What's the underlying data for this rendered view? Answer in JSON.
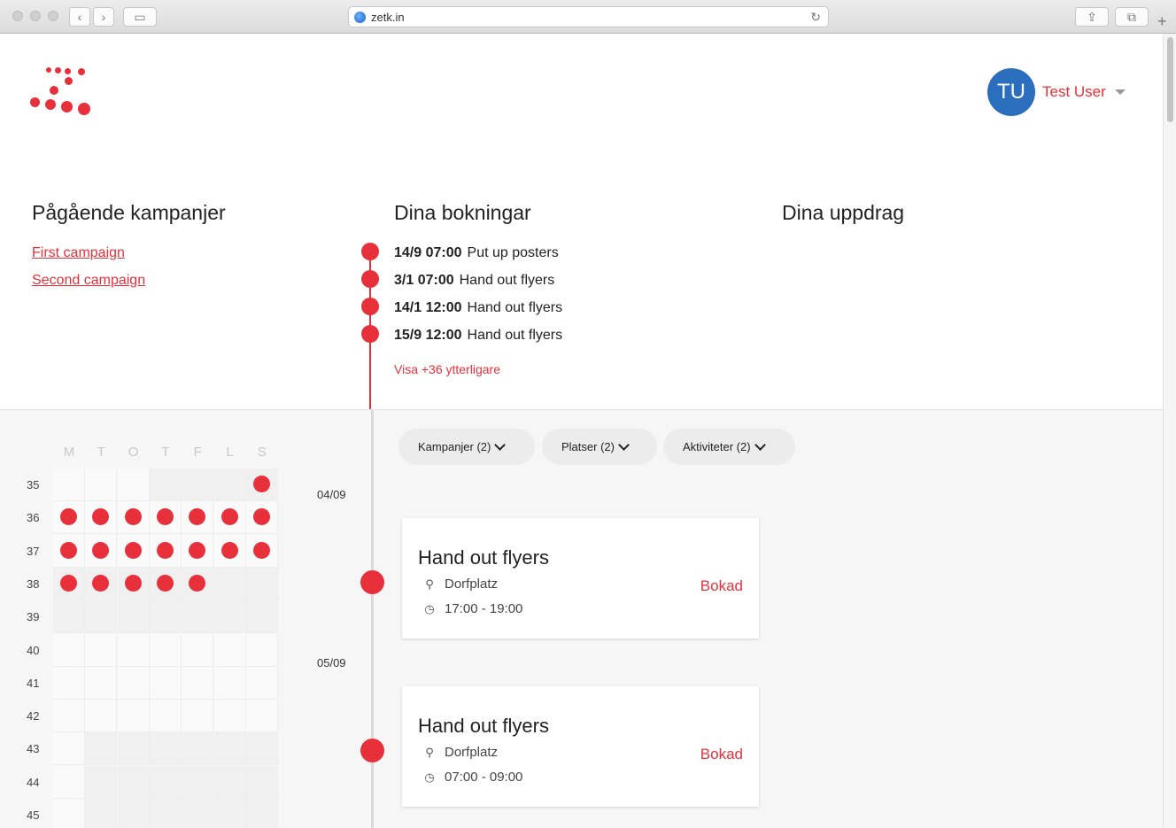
{
  "browser": {
    "url": "zetk.in"
  },
  "user": {
    "initials": "TU",
    "name": "Test User"
  },
  "columns": {
    "campaigns_title": "Pågående kampanjer",
    "bookings_title": "Dina bokningar",
    "assignments_title": "Dina uppdrag"
  },
  "campaigns": [
    "First campaign",
    "Second campaign"
  ],
  "bookings": [
    {
      "date": "14/9 07:00",
      "label": "Put up posters"
    },
    {
      "date": "3/1 07:00",
      "label": "Hand out flyers"
    },
    {
      "date": "14/1 12:00",
      "label": "Hand out flyers"
    },
    {
      "date": "15/9 12:00",
      "label": "Hand out flyers"
    }
  ],
  "show_more": "Visa +36 ytterligare",
  "calendar": {
    "days": [
      "M",
      "T",
      "O",
      "T",
      "F",
      "L",
      "S"
    ],
    "weeks": [
      "35",
      "36",
      "37",
      "38",
      "39",
      "40",
      "41",
      "42",
      "43",
      "44",
      "45"
    ],
    "events": [
      [
        0,
        0,
        0,
        0,
        0,
        0,
        1
      ],
      [
        1,
        1,
        1,
        1,
        1,
        1,
        1
      ],
      [
        1,
        1,
        1,
        1,
        1,
        1,
        1
      ],
      [
        1,
        1,
        1,
        1,
        1,
        0,
        0
      ],
      [
        0,
        0,
        0,
        0,
        0,
        0,
        0
      ],
      [
        0,
        0,
        0,
        0,
        0,
        0,
        0
      ],
      [
        0,
        0,
        0,
        0,
        0,
        0,
        0
      ],
      [
        0,
        0,
        0,
        0,
        0,
        0,
        0
      ],
      [
        0,
        0,
        0,
        0,
        0,
        0,
        0
      ],
      [
        0,
        0,
        0,
        0,
        0,
        0,
        0
      ],
      [
        0,
        0,
        0,
        0,
        0,
        0,
        0
      ]
    ]
  },
  "filters": [
    "Kampanjer (2)",
    "Platser (2)",
    "Aktiviteter (2)"
  ],
  "timeline": [
    {
      "date": "04/09",
      "title": "Hand out flyers",
      "location": "Dorfplatz",
      "time": "17:00 - 19:00",
      "status": "Bokad"
    },
    {
      "date": "05/09",
      "title": "Hand out flyers",
      "location": "Dorfplatz",
      "time": "07:00 - 09:00",
      "status": "Bokad"
    }
  ],
  "colors": {
    "accent": "#e8303b",
    "avatar": "#2a6ebd"
  }
}
